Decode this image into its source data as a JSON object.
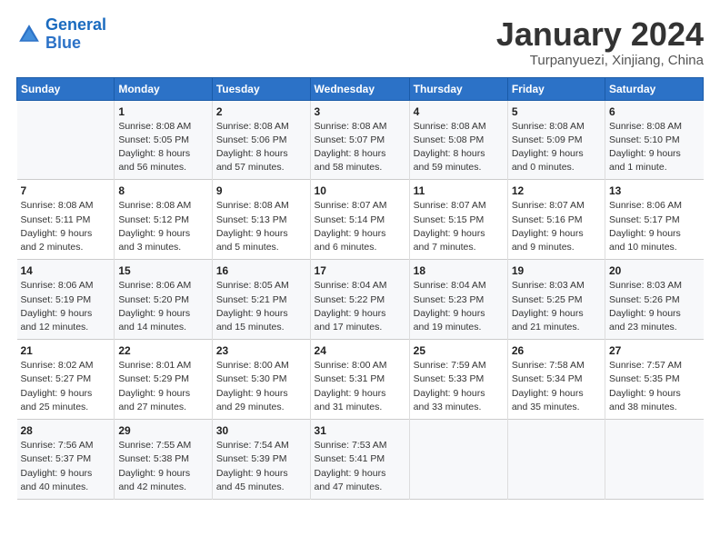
{
  "header": {
    "logo_line1": "General",
    "logo_line2": "Blue",
    "month_title": "January 2024",
    "subtitle": "Turpanyuezi, Xinjiang, China"
  },
  "weekdays": [
    "Sunday",
    "Monday",
    "Tuesday",
    "Wednesday",
    "Thursday",
    "Friday",
    "Saturday"
  ],
  "weeks": [
    [
      {
        "num": "",
        "info": ""
      },
      {
        "num": "1",
        "info": "Sunrise: 8:08 AM\nSunset: 5:05 PM\nDaylight: 8 hours\nand 56 minutes."
      },
      {
        "num": "2",
        "info": "Sunrise: 8:08 AM\nSunset: 5:06 PM\nDaylight: 8 hours\nand 57 minutes."
      },
      {
        "num": "3",
        "info": "Sunrise: 8:08 AM\nSunset: 5:07 PM\nDaylight: 8 hours\nand 58 minutes."
      },
      {
        "num": "4",
        "info": "Sunrise: 8:08 AM\nSunset: 5:08 PM\nDaylight: 8 hours\nand 59 minutes."
      },
      {
        "num": "5",
        "info": "Sunrise: 8:08 AM\nSunset: 5:09 PM\nDaylight: 9 hours\nand 0 minutes."
      },
      {
        "num": "6",
        "info": "Sunrise: 8:08 AM\nSunset: 5:10 PM\nDaylight: 9 hours\nand 1 minute."
      }
    ],
    [
      {
        "num": "7",
        "info": "Sunrise: 8:08 AM\nSunset: 5:11 PM\nDaylight: 9 hours\nand 2 minutes."
      },
      {
        "num": "8",
        "info": "Sunrise: 8:08 AM\nSunset: 5:12 PM\nDaylight: 9 hours\nand 3 minutes."
      },
      {
        "num": "9",
        "info": "Sunrise: 8:08 AM\nSunset: 5:13 PM\nDaylight: 9 hours\nand 5 minutes."
      },
      {
        "num": "10",
        "info": "Sunrise: 8:07 AM\nSunset: 5:14 PM\nDaylight: 9 hours\nand 6 minutes."
      },
      {
        "num": "11",
        "info": "Sunrise: 8:07 AM\nSunset: 5:15 PM\nDaylight: 9 hours\nand 7 minutes."
      },
      {
        "num": "12",
        "info": "Sunrise: 8:07 AM\nSunset: 5:16 PM\nDaylight: 9 hours\nand 9 minutes."
      },
      {
        "num": "13",
        "info": "Sunrise: 8:06 AM\nSunset: 5:17 PM\nDaylight: 9 hours\nand 10 minutes."
      }
    ],
    [
      {
        "num": "14",
        "info": "Sunrise: 8:06 AM\nSunset: 5:19 PM\nDaylight: 9 hours\nand 12 minutes."
      },
      {
        "num": "15",
        "info": "Sunrise: 8:06 AM\nSunset: 5:20 PM\nDaylight: 9 hours\nand 14 minutes."
      },
      {
        "num": "16",
        "info": "Sunrise: 8:05 AM\nSunset: 5:21 PM\nDaylight: 9 hours\nand 15 minutes."
      },
      {
        "num": "17",
        "info": "Sunrise: 8:04 AM\nSunset: 5:22 PM\nDaylight: 9 hours\nand 17 minutes."
      },
      {
        "num": "18",
        "info": "Sunrise: 8:04 AM\nSunset: 5:23 PM\nDaylight: 9 hours\nand 19 minutes."
      },
      {
        "num": "19",
        "info": "Sunrise: 8:03 AM\nSunset: 5:25 PM\nDaylight: 9 hours\nand 21 minutes."
      },
      {
        "num": "20",
        "info": "Sunrise: 8:03 AM\nSunset: 5:26 PM\nDaylight: 9 hours\nand 23 minutes."
      }
    ],
    [
      {
        "num": "21",
        "info": "Sunrise: 8:02 AM\nSunset: 5:27 PM\nDaylight: 9 hours\nand 25 minutes."
      },
      {
        "num": "22",
        "info": "Sunrise: 8:01 AM\nSunset: 5:29 PM\nDaylight: 9 hours\nand 27 minutes."
      },
      {
        "num": "23",
        "info": "Sunrise: 8:00 AM\nSunset: 5:30 PM\nDaylight: 9 hours\nand 29 minutes."
      },
      {
        "num": "24",
        "info": "Sunrise: 8:00 AM\nSunset: 5:31 PM\nDaylight: 9 hours\nand 31 minutes."
      },
      {
        "num": "25",
        "info": "Sunrise: 7:59 AM\nSunset: 5:33 PM\nDaylight: 9 hours\nand 33 minutes."
      },
      {
        "num": "26",
        "info": "Sunrise: 7:58 AM\nSunset: 5:34 PM\nDaylight: 9 hours\nand 35 minutes."
      },
      {
        "num": "27",
        "info": "Sunrise: 7:57 AM\nSunset: 5:35 PM\nDaylight: 9 hours\nand 38 minutes."
      }
    ],
    [
      {
        "num": "28",
        "info": "Sunrise: 7:56 AM\nSunset: 5:37 PM\nDaylight: 9 hours\nand 40 minutes."
      },
      {
        "num": "29",
        "info": "Sunrise: 7:55 AM\nSunset: 5:38 PM\nDaylight: 9 hours\nand 42 minutes."
      },
      {
        "num": "30",
        "info": "Sunrise: 7:54 AM\nSunset: 5:39 PM\nDaylight: 9 hours\nand 45 minutes."
      },
      {
        "num": "31",
        "info": "Sunrise: 7:53 AM\nSunset: 5:41 PM\nDaylight: 9 hours\nand 47 minutes."
      },
      {
        "num": "",
        "info": ""
      },
      {
        "num": "",
        "info": ""
      },
      {
        "num": "",
        "info": ""
      }
    ]
  ]
}
